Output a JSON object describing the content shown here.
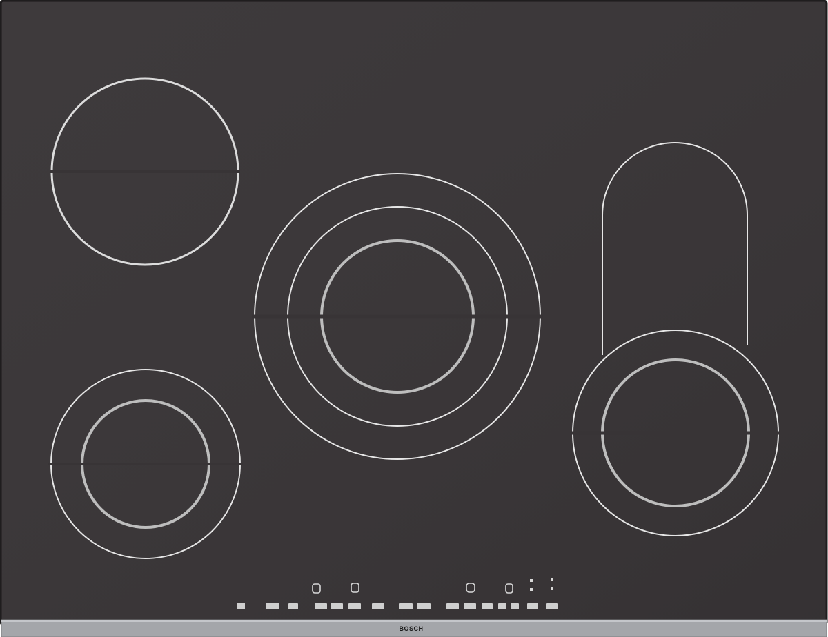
{
  "product": {
    "brand": "BOSCH",
    "colors": {
      "glass": "#383436",
      "frame": "#1f1d1e",
      "trim": "#a4a6aa",
      "ring_outer": "#e4e4e4",
      "ring_inner": "#bdbdbd",
      "control_symbol": "#d8d8d8",
      "brand_text": "#1a1a1a"
    },
    "zones": [
      {
        "id": "rear-left",
        "shape": "single-circle"
      },
      {
        "id": "center",
        "shape": "triple-circle"
      },
      {
        "id": "front-left",
        "shape": "double-circle"
      },
      {
        "id": "right",
        "shape": "oval-with-double-circle"
      }
    ],
    "controls": {
      "top_keys": [
        "timer-key-1",
        "timer-key-2",
        "timer-key-3",
        "timer-key-4",
        "indicator-dots-1",
        "indicator-dots-2"
      ],
      "power_scale_keys": 16
    }
  }
}
